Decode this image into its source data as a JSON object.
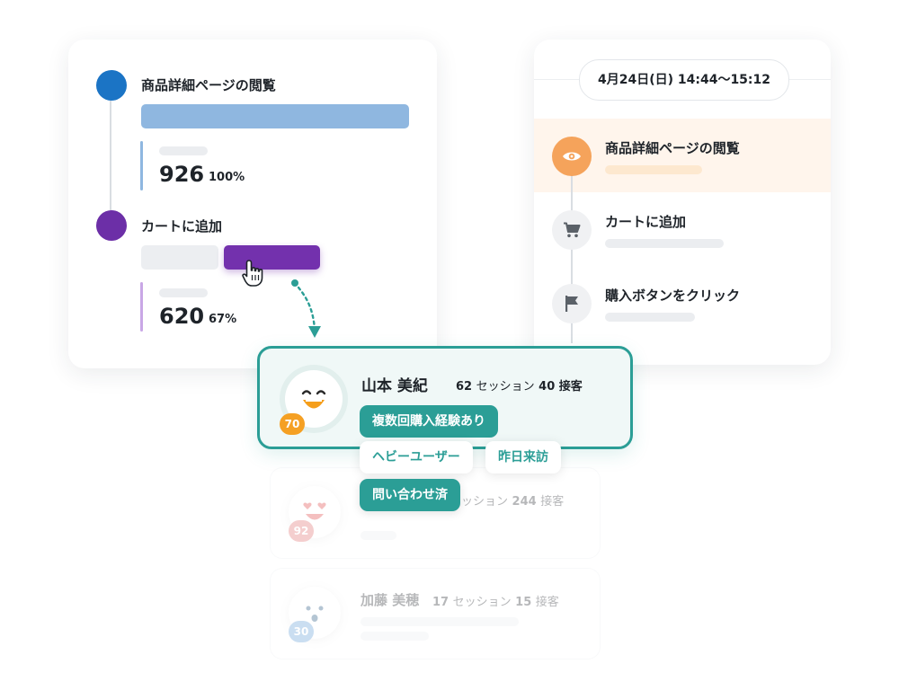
{
  "colors": {
    "step1_dot": "#1b74c5",
    "step1_bar": "#8fb7e0",
    "step2_dot": "#6c2fa7",
    "step2_bar": "#7331ad",
    "accent_teal": "#2b9e96",
    "accent_orange": "#f5a35b",
    "highlight_row": "#fff5ec"
  },
  "funnel": {
    "steps": [
      {
        "label": "商品詳細ページの閲覧",
        "value": "926",
        "percent": "100%",
        "fraction": 1.0
      },
      {
        "label": "カートに追加",
        "value": "620",
        "percent": "67%",
        "fraction": 0.67
      }
    ]
  },
  "timeline": {
    "date_range": "4月24日(日) 14:44〜15:12",
    "events": [
      {
        "label": "商品詳細ページの閲覧",
        "icon": "eye-icon",
        "active": true
      },
      {
        "label": "カートに追加",
        "icon": "cart-icon",
        "active": false
      },
      {
        "label": "購入ボタンをクリック",
        "icon": "flag-icon",
        "active": false
      }
    ]
  },
  "users": [
    {
      "name": "山本 美紀",
      "sessions": "62",
      "sessions_label": "セッション",
      "visits": "40",
      "visits_label": "接客",
      "score": "70",
      "avatar": "laughing-face",
      "tags": [
        "複数回購入経験あり",
        "ヘビーユーザー",
        "昨日来訪",
        "問い合わせ済"
      ]
    },
    {
      "name": "",
      "sessions_partial": "ッション",
      "visits": "244",
      "visits_label": "接客",
      "score": "92",
      "avatar": "heart-eyes-face"
    },
    {
      "name": "加藤 美穂",
      "sessions": "17",
      "sessions_label": "セッション",
      "visits": "15",
      "visits_label": "接客",
      "score": "30",
      "avatar": "surprised-face"
    }
  ]
}
